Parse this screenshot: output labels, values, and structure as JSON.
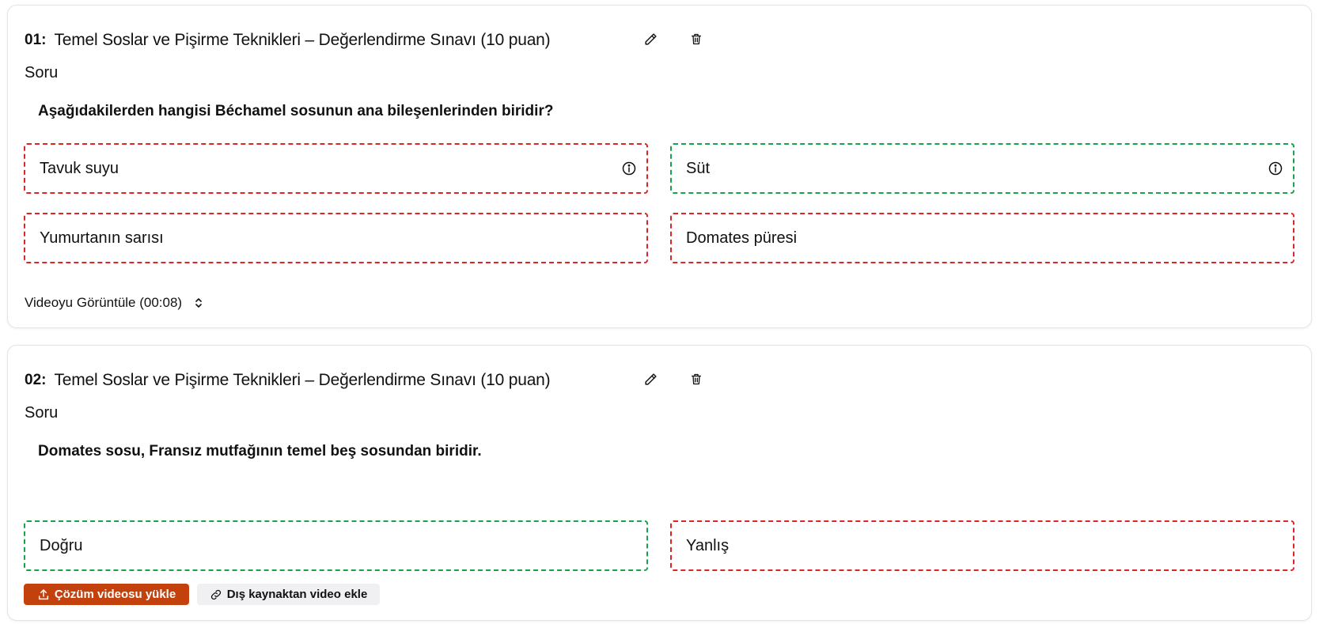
{
  "questions": [
    {
      "number": "01:",
      "title": "Temel Soslar ve Pişirme Teknikleri – Değerlendirme Sınavı (10 puan)",
      "section_label": "Soru",
      "text": "Aşağıdakilerden hangisi Béchamel sosunun ana bileşenlerinden biridir?",
      "options": [
        {
          "label": "Tavuk suyu",
          "correct": false,
          "icon": "info-icon"
        },
        {
          "label": "Süt",
          "correct": true,
          "icon": "info-icon"
        },
        {
          "label": "Yumurtanın sarısı",
          "correct": false
        },
        {
          "label": "Domates püresi",
          "correct": false
        }
      ],
      "video_toggle": "Videoyu Görüntüle (00:08)"
    },
    {
      "number": "02:",
      "title": "Temel Soslar ve Pişirme Teknikleri – Değerlendirme Sınavı (10 puan)",
      "section_label": "Soru",
      "text": "Domates sosu, Fransız mutfağının temel beş sosundan biridir.",
      "options": [
        {
          "label": "Doğru",
          "correct": true
        },
        {
          "label": "Yanlış",
          "correct": false
        }
      ],
      "upload_button": "Çözüm videosu yükle",
      "external_button": "Dış kaynaktan video ekle"
    }
  ],
  "colors": {
    "correct_border": "#16a34a",
    "wrong_border": "#dc2626",
    "accent": "#c2410c"
  },
  "icons": [
    "pencil-icon",
    "trash-icon",
    "info-icon",
    "chevron-up-down-icon",
    "upload-icon",
    "link-icon"
  ]
}
